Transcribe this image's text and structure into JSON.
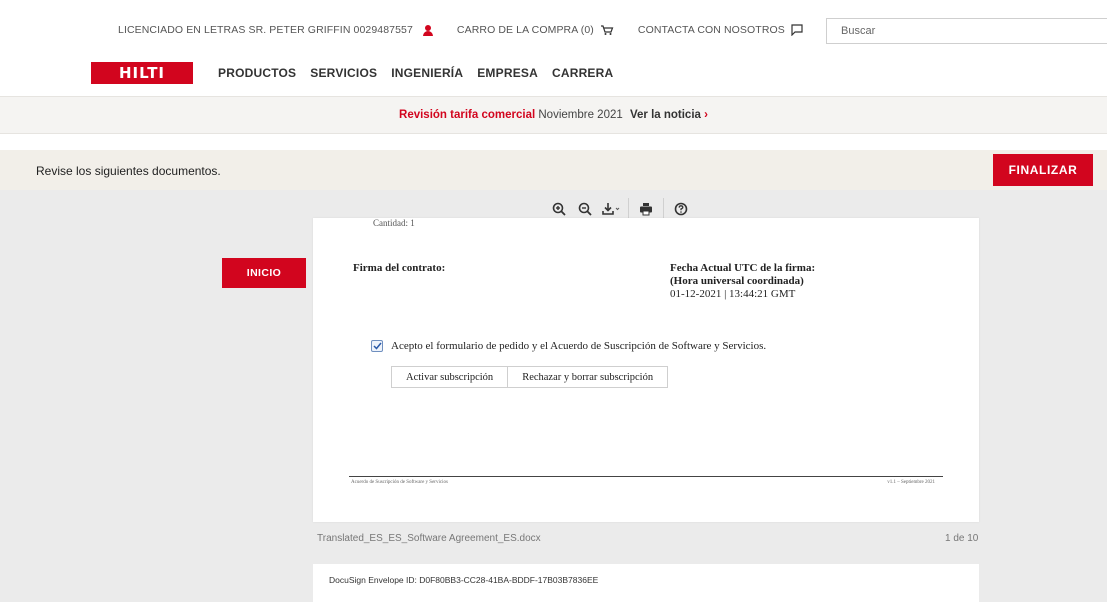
{
  "header": {
    "user_label": "LICENCIADO EN LETRAS SR. PETER GRIFFIN 0029487557",
    "cart_label": "CARRO DE LA COMPRA (0)",
    "contact_label": "CONTACTA CON NOSOTROS",
    "search_placeholder": "Buscar",
    "icons": {
      "user": "user-icon",
      "cart": "cart-icon",
      "contact": "chat-icon"
    },
    "brand_color": "#d2051e"
  },
  "nav": {
    "logo_text": "HILTI",
    "items": [
      "PRODUCTOS",
      "SERVICIOS",
      "INGENIERÍA",
      "EMPRESA",
      "CARRERA"
    ]
  },
  "announcement": {
    "highlight": "Revisión tarifa comercial",
    "text": "Noviembre 2021",
    "link": "Ver la noticia",
    "chevron": "›"
  },
  "action_bar": {
    "message": "Revise los siguientes documentos.",
    "finish_label": "FINALIZAR"
  },
  "toolbar": {
    "icons": [
      "zoom-in-icon",
      "zoom-out-icon",
      "download-icon",
      "print-icon",
      "help-icon"
    ]
  },
  "document": {
    "cut_text": "Cantidad:  1",
    "signature_label": "Firma del contrato:",
    "date_title_1": "Fecha Actual UTC de la firma:",
    "date_title_2": "(Hora universal coordinada)",
    "date_value": "01-12-2021 | 13:44:21 GMT",
    "accept_text": "Acepto el formulario de pedido y el Acuerdo de Suscripción de Software y Servicios.",
    "accept_checked": true,
    "activate_label": "Activar subscripción",
    "reject_label": "Rechazar y borrar subscripción",
    "footer_left": "Acuerdo de Suscripción de Software y Servicios",
    "footer_right": "v1.1 – Septiembre 2021",
    "file_name": "Translated_ES_ES_Software Agreement_ES.docx",
    "page_count": "1 de 10",
    "envelope_id": "DocuSign Envelope ID: D0F80BB3-CC28-41BA-BDDF-17B03B7836EE"
  },
  "inicio_label": "INICIO"
}
